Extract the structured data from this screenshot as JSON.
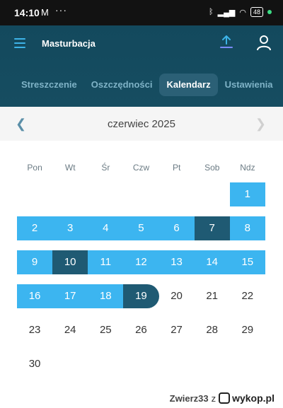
{
  "status_bar": {
    "time": "14:10",
    "battery": "48"
  },
  "app_bar": {
    "title": "Masturbacja"
  },
  "tabs": [
    {
      "label": "Streszczenie"
    },
    {
      "label": "Oszczędności"
    },
    {
      "label": "Kalendarz",
      "active": true
    },
    {
      "label": "Ustawienia"
    }
  ],
  "calendar": {
    "month_label": "czerwiec 2025",
    "weekdays": [
      "Pon",
      "Wt",
      "Śr",
      "Czw",
      "Pt",
      "Sob",
      "Ndz"
    ],
    "weeks": [
      [
        null,
        null,
        null,
        null,
        null,
        null,
        1
      ],
      [
        2,
        3,
        4,
        5,
        6,
        7,
        8
      ],
      [
        9,
        10,
        11,
        12,
        13,
        14,
        15
      ],
      [
        16,
        17,
        18,
        19,
        20,
        21,
        22
      ],
      [
        23,
        24,
        25,
        26,
        27,
        28,
        29
      ],
      [
        30,
        null,
        null,
        null,
        null,
        null,
        null
      ]
    ],
    "highlighted_days": [
      1,
      2,
      3,
      4,
      5,
      6,
      7,
      8,
      9,
      10,
      11,
      12,
      13,
      14,
      15,
      16,
      17,
      18,
      19
    ],
    "dark_days": [
      7,
      10,
      19
    ],
    "last_highlighted_day": 19,
    "highlight_color": "#3cb5f0",
    "dark_color": "#1f5a73"
  },
  "watermark": {
    "user": "Zwierz33",
    "connector": "z",
    "site": "wykop.pl"
  }
}
